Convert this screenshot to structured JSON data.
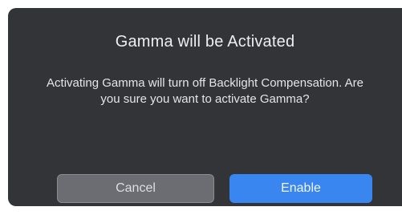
{
  "dialog": {
    "title": "Gamma will be Activated",
    "message": "Activating Gamma will turn off Backlight Compensation. Are you sure you want to activate Gamma?",
    "buttons": {
      "cancel_label": "Cancel",
      "enable_label": "Enable"
    },
    "colors": {
      "background": "#323438",
      "primary_button": "#3a86f1",
      "secondary_button": "#6b6d72"
    }
  }
}
